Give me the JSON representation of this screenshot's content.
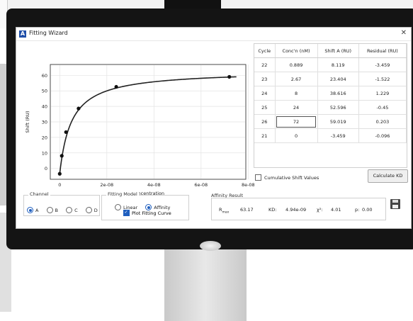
{
  "window": {
    "title": "Fitting Wizard",
    "close_glyph": "✕",
    "app_icon_letter": "A"
  },
  "chart_data": {
    "type": "scatter",
    "xlabel": "Concentration",
    "ylabel": "Shift (RU)",
    "xlim": [
      -4e-09,
      7.9e-08
    ],
    "ylim": [
      -7,
      67
    ],
    "yticks": [
      0,
      10,
      20,
      30,
      40,
      50,
      60
    ],
    "xticks": [
      0,
      2e-08,
      4e-08,
      6e-08,
      8e-08
    ],
    "xtick_labels": [
      "0",
      "2e-08",
      "4e-08",
      "6e-08",
      "8e-08"
    ],
    "grid": true,
    "points": [
      {
        "x": 0,
        "y": -3.459
      },
      {
        "x": 8.89e-10,
        "y": 8.119
      },
      {
        "x": 2.67e-09,
        "y": 23.404
      },
      {
        "x": 8e-09,
        "y": 38.616
      },
      {
        "x": 2.4e-08,
        "y": 52.596
      },
      {
        "x": 7.2e-08,
        "y": 59.019
      }
    ],
    "fit": {
      "rmax": 63.17,
      "kd": 4.94e-09,
      "offset": -3.459,
      "x_end": 7.5e-08
    }
  },
  "table": {
    "headers": [
      "Cycle",
      "Conc'n (nM)",
      "Shift A (RU)",
      "Residual (RU)"
    ],
    "rows": [
      [
        "22",
        "0.889",
        "8.119",
        "-3.459"
      ],
      [
        "23",
        "2.67",
        "23.404",
        "-1.522"
      ],
      [
        "24",
        "8",
        "38.616",
        "1.229"
      ],
      [
        "25",
        "24",
        "52.596",
        "-0.45"
      ],
      [
        "26",
        "72",
        "59.019",
        "0.203"
      ],
      [
        "21",
        "0",
        "-3.459",
        "-0.096"
      ]
    ]
  },
  "controls": {
    "cumulative_label": "Cumulative Shift Values",
    "calculate_label": "Calculate KD",
    "channel_title": "Channel",
    "channels": [
      "A",
      "B",
      "C",
      "D"
    ],
    "model_title": "Fitting Model",
    "model_linear": "Linear",
    "model_affinity": "Affinity",
    "plot_curve_label": "Plot Fitting Curve"
  },
  "result": {
    "title": "Affinity Result",
    "rmax_label": "R",
    "rmax_sub": "max",
    "rmax_value": "63.17",
    "kd_label": "KD:",
    "kd_value": "4.94e-09",
    "chi_label": "χ²:",
    "chi_value": "4.01",
    "p_label": "p:",
    "p_value": "0.00"
  }
}
